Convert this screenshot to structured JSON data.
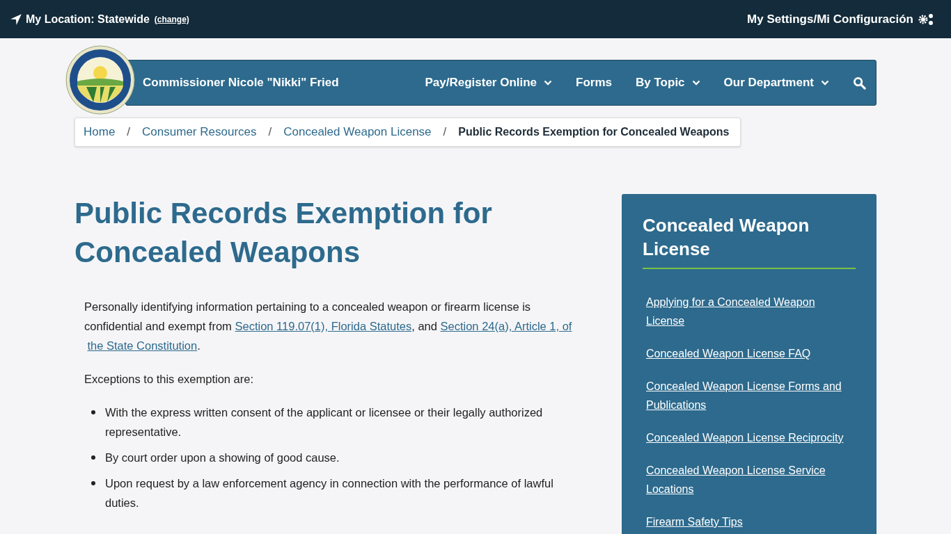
{
  "top_bar": {
    "location_label": "My Location: Statewide",
    "change_link": "(change)",
    "settings_link": "My Settings/Mi Configuración"
  },
  "header": {
    "title": "Commissioner Nicole \"Nikki\" Fried",
    "nav": [
      {
        "label": "Pay/Register Online",
        "has_menu": true
      },
      {
        "label": "Forms",
        "has_menu": false
      },
      {
        "label": "By Topic",
        "has_menu": true
      },
      {
        "label": "Our Department",
        "has_menu": true
      }
    ]
  },
  "breadcrumb": [
    {
      "label": "Home",
      "current": false
    },
    {
      "label": "Consumer Resources",
      "current": false
    },
    {
      "label": "Concealed Weapon License",
      "current": false
    },
    {
      "label": "Public Records Exemption for Concealed Weapons",
      "current": true
    }
  ],
  "breadcrumb_separator": "/",
  "page_title": "Public Records Exemption for Concealed Weapons",
  "intro": [
    {
      "text": "Personally identifying information pertaining to a concealed weapon or firearm license is confidential and exempt from ",
      "kind": "text"
    },
    {
      "text": "Section 119.07(1), Florida Statutes",
      "kind": "link"
    },
    {
      "text": ", and ",
      "kind": "text"
    },
    {
      "text": "Section 24(a), Article 1, of",
      "kind": "link"
    },
    {
      "text": "the State Constitution",
      "kind": "link"
    },
    {
      "text": ".",
      "kind": "text"
    }
  ],
  "exceptions_intro": "Exceptions to this exemption are:",
  "exceptions": [
    "With the express written consent of the applicant or licensee or their legally authorized representative.",
    "By court order upon a showing of good cause.",
    "Upon request by a law enforcement agency in connection with the performance of lawful duties."
  ],
  "sidebar": {
    "title": "Concealed Weapon License",
    "links": [
      "Applying for a Concealed Weapon License",
      "Concealed Weapon License FAQ",
      "Concealed Weapon License Forms and Publications",
      "Concealed Weapon License Reciprocity",
      "Concealed Weapon License Service Locations",
      "Firearm Safety Tips"
    ]
  }
}
